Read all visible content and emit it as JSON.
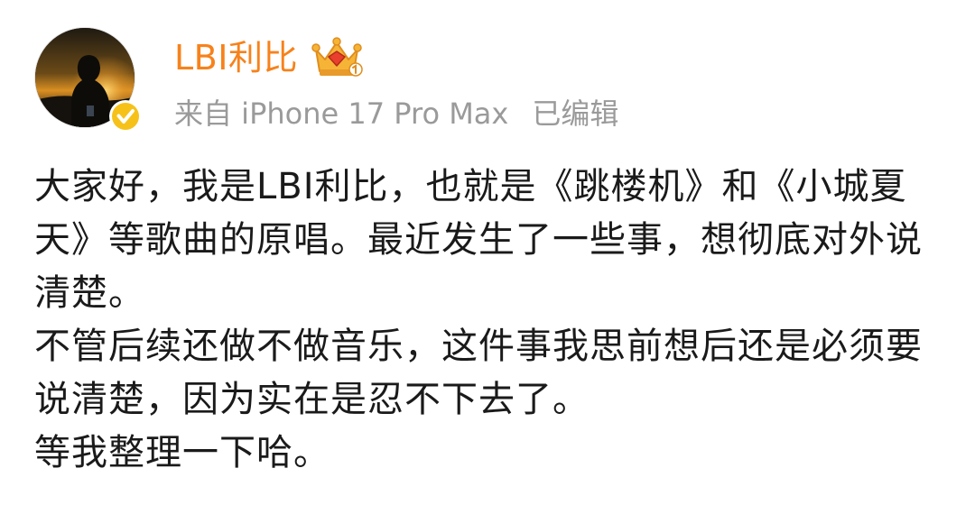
{
  "post": {
    "author": {
      "name": "LBI利比",
      "verified_icon": "verified-badge-icon",
      "crown_icon": "crown-badge-icon"
    },
    "meta": {
      "source": "来自 iPhone 17 Pro Max",
      "edited": "已编辑"
    },
    "paragraphs": [
      "大家好，我是LBI利比，也就是《跳楼机》和《小城夏天》等歌曲的原唱。最近发生了一些事，想彻底对外说清楚。",
      "不管后续还做不做音乐，这件事我思前想后还是必须要说清楚，因为实在是忍不下去了。",
      "等我整理一下哈。"
    ]
  },
  "colors": {
    "username": "#f7821b",
    "meta": "#9a9a9a",
    "text": "#1a1a1a",
    "verified": "#f6c21a",
    "crown": "#f2a93b"
  }
}
